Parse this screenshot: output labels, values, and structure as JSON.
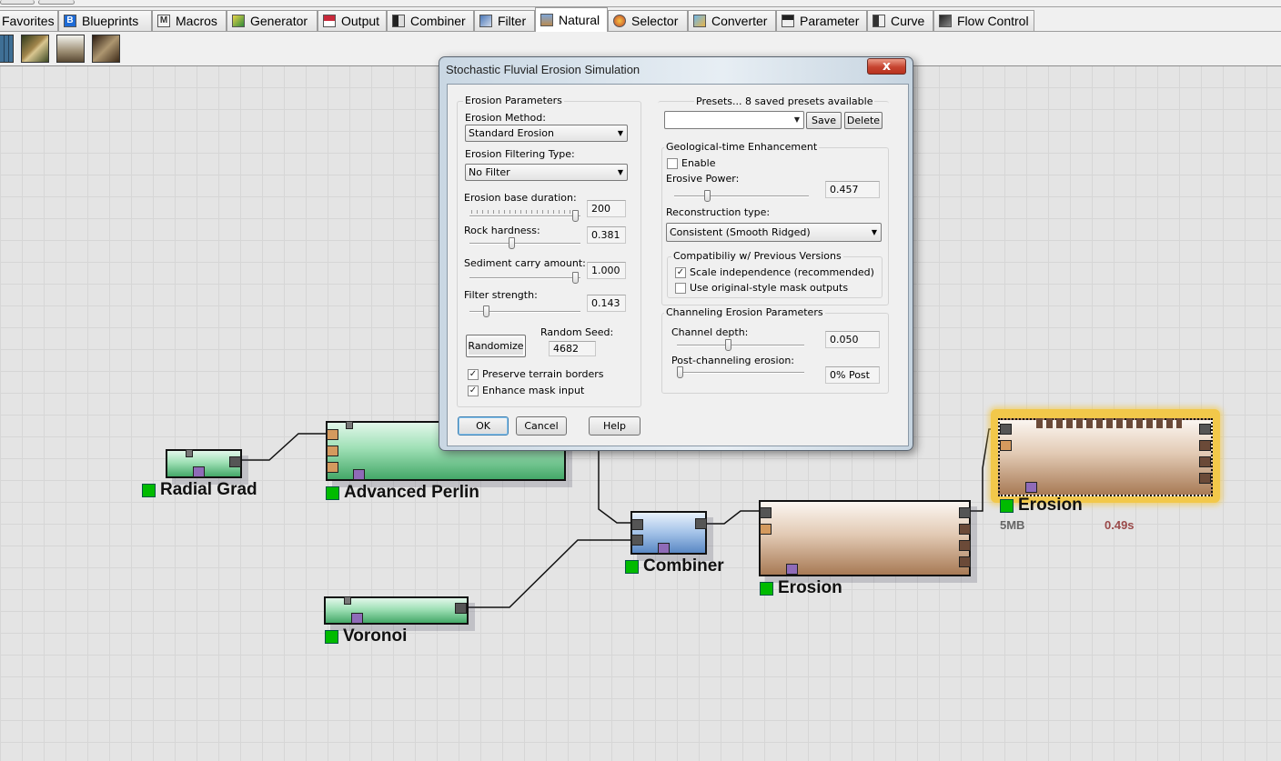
{
  "tabs": [
    {
      "label": "Favorites",
      "icon": "star-icon"
    },
    {
      "label": "Blueprints",
      "icon": "blueprints-b-icon",
      "glyph": "B"
    },
    {
      "label": "Macros",
      "icon": "macros-m-icon",
      "glyph": "M"
    },
    {
      "label": "Generator",
      "icon": "generator-icon"
    },
    {
      "label": "Output",
      "icon": "output-disk-icon"
    },
    {
      "label": "Combiner",
      "icon": "combiner-icon"
    },
    {
      "label": "Filter",
      "icon": "filter-icon"
    },
    {
      "label": "Natural",
      "icon": "natural-icon",
      "active": true
    },
    {
      "label": "Selector",
      "icon": "selector-icon"
    },
    {
      "label": "Converter",
      "icon": "converter-icon"
    },
    {
      "label": "Parameter",
      "icon": "parameter-icon"
    },
    {
      "label": "Curve",
      "icon": "curve-icon"
    },
    {
      "label": "Flow Control",
      "icon": "flow-control-icon"
    }
  ],
  "toolbar_thumbs": [
    "blue-grid-thumbnail",
    "erosion-terrain-thumbnail",
    "water-terrain-thumbnail",
    "canyon-terrain-thumbnail"
  ],
  "nodes": {
    "radial_grad": {
      "label": "Radial Grad"
    },
    "advanced_perlin": {
      "label": "Advanced Perlin"
    },
    "voronoi": {
      "label": "Voronoi"
    },
    "combiner": {
      "label": "Combiner"
    },
    "erosion1": {
      "label": "Erosion"
    },
    "erosion2": {
      "label": "Erosion",
      "memory": "5MB",
      "time": "0.49s"
    }
  },
  "dialog": {
    "title": "Stochastic Fluvial Erosion Simulation",
    "close_label": "x",
    "erosion_params": {
      "group_title": "Erosion Parameters",
      "method_label": "Erosion Method:",
      "method_value": "Standard Erosion",
      "filtering_label": "Erosion Filtering Type:",
      "filtering_value": "No Filter",
      "base_duration_label": "Erosion base duration:",
      "base_duration_value": "200",
      "rock_hardness_label": "Rock hardness:",
      "rock_hardness_value": "0.381",
      "sediment_label": "Sediment carry amount:",
      "sediment_value": "1.000",
      "filter_strength_label": "Filter strength:",
      "filter_strength_value": "0.143",
      "randomize_label": "Randomize",
      "seed_label": "Random Seed:",
      "seed_value": "4682",
      "preserve_borders_label": "Preserve terrain borders",
      "preserve_borders_checked": true,
      "enhance_mask_label": "Enhance mask input",
      "enhance_mask_checked": true
    },
    "presets": {
      "title": "Presets... 8 saved presets available",
      "value": "",
      "save_label": "Save",
      "delete_label": "Delete"
    },
    "geo_time": {
      "group_title": "Geological-time Enhancement",
      "enable_label": "Enable",
      "enable_checked": false,
      "erosive_power_label": "Erosive Power:",
      "erosive_power_value": "0.457",
      "reconstruction_label": "Reconstruction type:",
      "reconstruction_value": "Consistent (Smooth Ridged)"
    },
    "compat": {
      "group_title": "Compatibiliy w/ Previous Versions",
      "scale_label": "Scale independence (recommended)",
      "scale_checked": true,
      "mask_label": "Use original-style mask outputs",
      "mask_checked": false
    },
    "channeling": {
      "group_title": "Channeling Erosion Parameters",
      "depth_label": "Channel depth:",
      "depth_value": "0.050",
      "post_label": "Post-channeling erosion:",
      "post_value": "0% Post"
    },
    "ok_label": "OK",
    "cancel_label": "Cancel",
    "help_label": "Help"
  },
  "check_glyph": "✓",
  "colors": {
    "canvas_bg": "#e4e4e4",
    "generator_node": "#9fe0b6",
    "combiner_node": "#a3c2e8",
    "erosion_node": "#e2cab4",
    "selected_glow": "#f2c84a",
    "status_green": "#00bb00",
    "memory_text": "#666666",
    "time_text": "#9a4a4a",
    "close_button": "#c64430"
  }
}
